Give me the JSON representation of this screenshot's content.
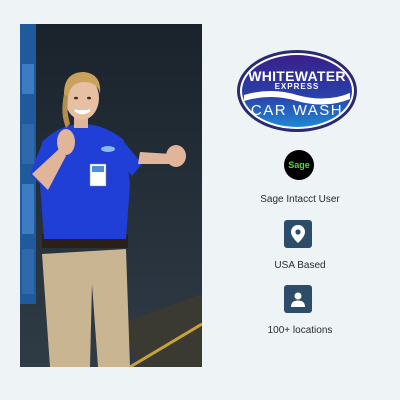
{
  "photo": {
    "description_icon": "person-photo"
  },
  "logo": {
    "line1": "WHITEWATER",
    "line2": "EXPRESS",
    "line3": "CAR WASH",
    "colors": {
      "purple": "#3a1f8a",
      "blue": "#1e88d6",
      "border": "#ffffff"
    }
  },
  "features": [
    {
      "icon": "sage-logo-icon",
      "badge_text": "Sage",
      "label": "Sage Intacct User"
    },
    {
      "icon": "location-pin-icon",
      "label": "USA Based"
    },
    {
      "icon": "person-icon",
      "label": "100+ locations"
    }
  ],
  "colors": {
    "background": "#eef3f6",
    "icon_square": "#2d4c6a",
    "sage_green": "#5ed63a",
    "text": "#2b2b2b"
  }
}
